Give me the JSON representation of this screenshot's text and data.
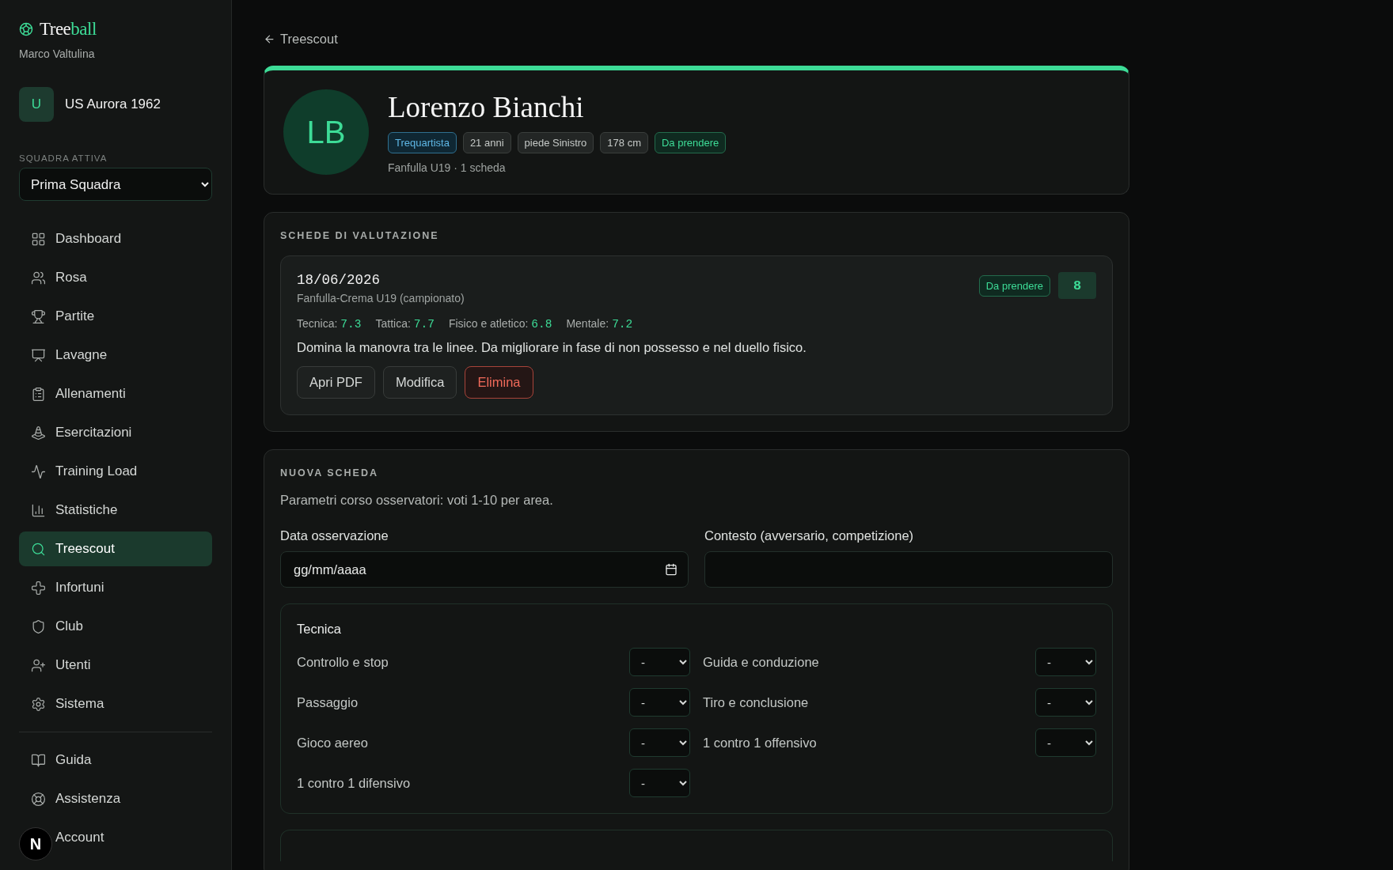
{
  "sidebar": {
    "logo": {
      "part_1": "Tree",
      "part_2": "ball"
    },
    "user": "Marco Valtulina",
    "club": {
      "initial": "U",
      "name": "US Aurora 1962"
    },
    "team_label": "SQUADRA ATTIVA",
    "team_select": "Prima Squadra",
    "nav": [
      {
        "label": "Dashboard",
        "selected": false
      },
      {
        "label": "Rosa",
        "selected": false
      },
      {
        "label": "Partite",
        "selected": false
      },
      {
        "label": "Lavagne",
        "selected": false
      },
      {
        "label": "Allenamenti",
        "selected": false
      },
      {
        "label": "Esercitazioni",
        "selected": false
      },
      {
        "label": "Training Load",
        "selected": false
      },
      {
        "label": "Statistiche",
        "selected": false
      },
      {
        "label": "Treescout",
        "selected": true
      },
      {
        "label": "Infortuni",
        "selected": false
      },
      {
        "label": "Club",
        "selected": false
      },
      {
        "label": "Utenti",
        "selected": false
      },
      {
        "label": "Sistema",
        "selected": false
      }
    ],
    "footer_nav": [
      {
        "label": "Guida",
        "selected": false
      },
      {
        "label": "Assistenza",
        "selected": false
      },
      {
        "label": "Account",
        "selected": false
      }
    ]
  },
  "dev_badge": "N",
  "back_link": "Treescout",
  "player": {
    "initials": "LB",
    "name": "Lorenzo Bianchi",
    "tags": [
      {
        "label": "Trequartista",
        "kind": "role"
      },
      {
        "label": "21 anni",
        "kind": "info"
      },
      {
        "label": "piede Sinistro",
        "kind": "info"
      },
      {
        "label": "178 cm",
        "kind": "info"
      },
      {
        "label": "Da prendere",
        "kind": "verdict"
      }
    ],
    "meta": "Fanfulla U19 · 1 scheda"
  },
  "evaluations": {
    "title": "SCHEDE DI VALUTAZIONE",
    "items": [
      {
        "date": "18/06/2026",
        "context": "Fanfulla-Crema U19 (campionato)",
        "verdict": "Da prendere",
        "score": "8",
        "areas": [
          {
            "label": "Tecnica:",
            "value": "7.3"
          },
          {
            "label": "Tattica:",
            "value": "7.7"
          },
          {
            "label": "Fisico e atletico:",
            "value": "6.8"
          },
          {
            "label": "Mentale:",
            "value": "7.2"
          }
        ],
        "note": "Domina la manovra tra le linee. Da migliorare in fase di non possesso e nel duello fisico.",
        "actions": [
          {
            "label": "Apri PDF",
            "kind": "default"
          },
          {
            "label": "Modifica",
            "kind": "default"
          },
          {
            "label": "Elimina",
            "kind": "danger"
          }
        ]
      }
    ]
  },
  "new_form": {
    "title": "NUOVA SCHEDA",
    "hint": "Parametri corso osservatori: voti 1-10 per area.",
    "fields": [
      {
        "label": "Data osservazione",
        "kind": "date",
        "placeholder": "gg/mm/aaaa"
      },
      {
        "label": "Contesto (avversario, competizione)",
        "kind": "text"
      }
    ],
    "sections": [
      {
        "title": "Tecnica",
        "criteria": [
          {
            "label": "Controllo e stop",
            "value": "-"
          },
          {
            "label": "Guida e conduzione",
            "value": "-"
          },
          {
            "label": "Passaggio",
            "value": "-"
          },
          {
            "label": "Tiro e conclusione",
            "value": "-"
          },
          {
            "label": "Gioco aereo",
            "value": "-"
          },
          {
            "label": "1 contro 1 offensivo",
            "value": "-"
          },
          {
            "label": "1 contro 1 difensivo",
            "value": "-"
          }
        ]
      }
    ]
  }
}
